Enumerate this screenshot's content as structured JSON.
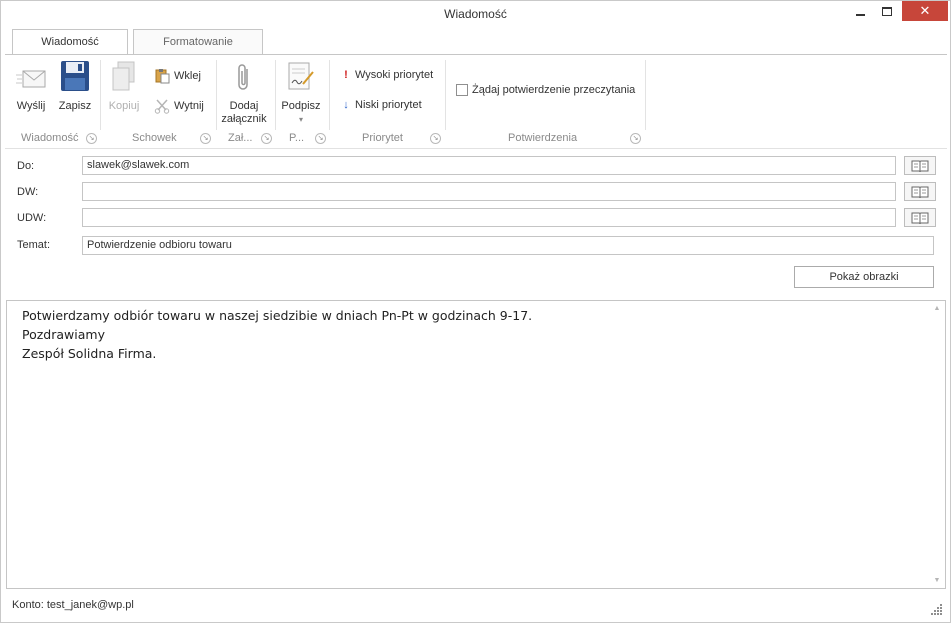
{
  "window": {
    "title": "Wiadomość",
    "close_glyph": "✕"
  },
  "tabs": [
    {
      "label": "Wiadomość",
      "active": true
    },
    {
      "label": "Formatowanie",
      "active": false
    }
  ],
  "ribbon": {
    "send_label": "Wyślij",
    "save_label": "Zapisz",
    "copy_label": "Kopiuj",
    "paste_label": "Wklej",
    "cut_label": "Wytnij",
    "attach_label_1": "Dodaj",
    "attach_label_2": "załącznik",
    "sign_label": "Podpisz",
    "sign_arrow": "▾",
    "high_priority_label": "Wysoki priorytet",
    "low_priority_label": "Niski priorytet",
    "read_receipt_label": "Żądaj potwierdzenie przeczytania",
    "launcher_glyph": "↘",
    "groups": {
      "message": "Wiadomość",
      "clipboard": "Schowek",
      "attachments": "Zał...",
      "signature": "P...",
      "priority": "Priorytet",
      "confirmations": "Potwierdzenia"
    }
  },
  "fields": {
    "to_label": "Do:",
    "to_value": "slawek@slawek.com",
    "cc_label": "DW:",
    "cc_value": "",
    "bcc_label": "UDW:",
    "bcc_value": "",
    "subject_label": "Temat:",
    "subject_value": "Potwierdzenie odbioru towaru"
  },
  "show_images_label": "Pokaż obrazki",
  "body_lines": [
    "Potwierdzamy odbiór towaru w naszej siedzibie w dniach Pn-Pt w godzinach 9-17.",
    "Pozdrawiamy",
    "Zespół Solidna Firma."
  ],
  "scroll": {
    "up": "▲",
    "down": "▼"
  },
  "status": {
    "account": "Konto: test_janek@wp.pl"
  },
  "colors": {
    "close_button": "#c7463a",
    "high_priority": "#d02020",
    "low_priority": "#2b63c9",
    "save_icon": "#2b4f8a"
  }
}
